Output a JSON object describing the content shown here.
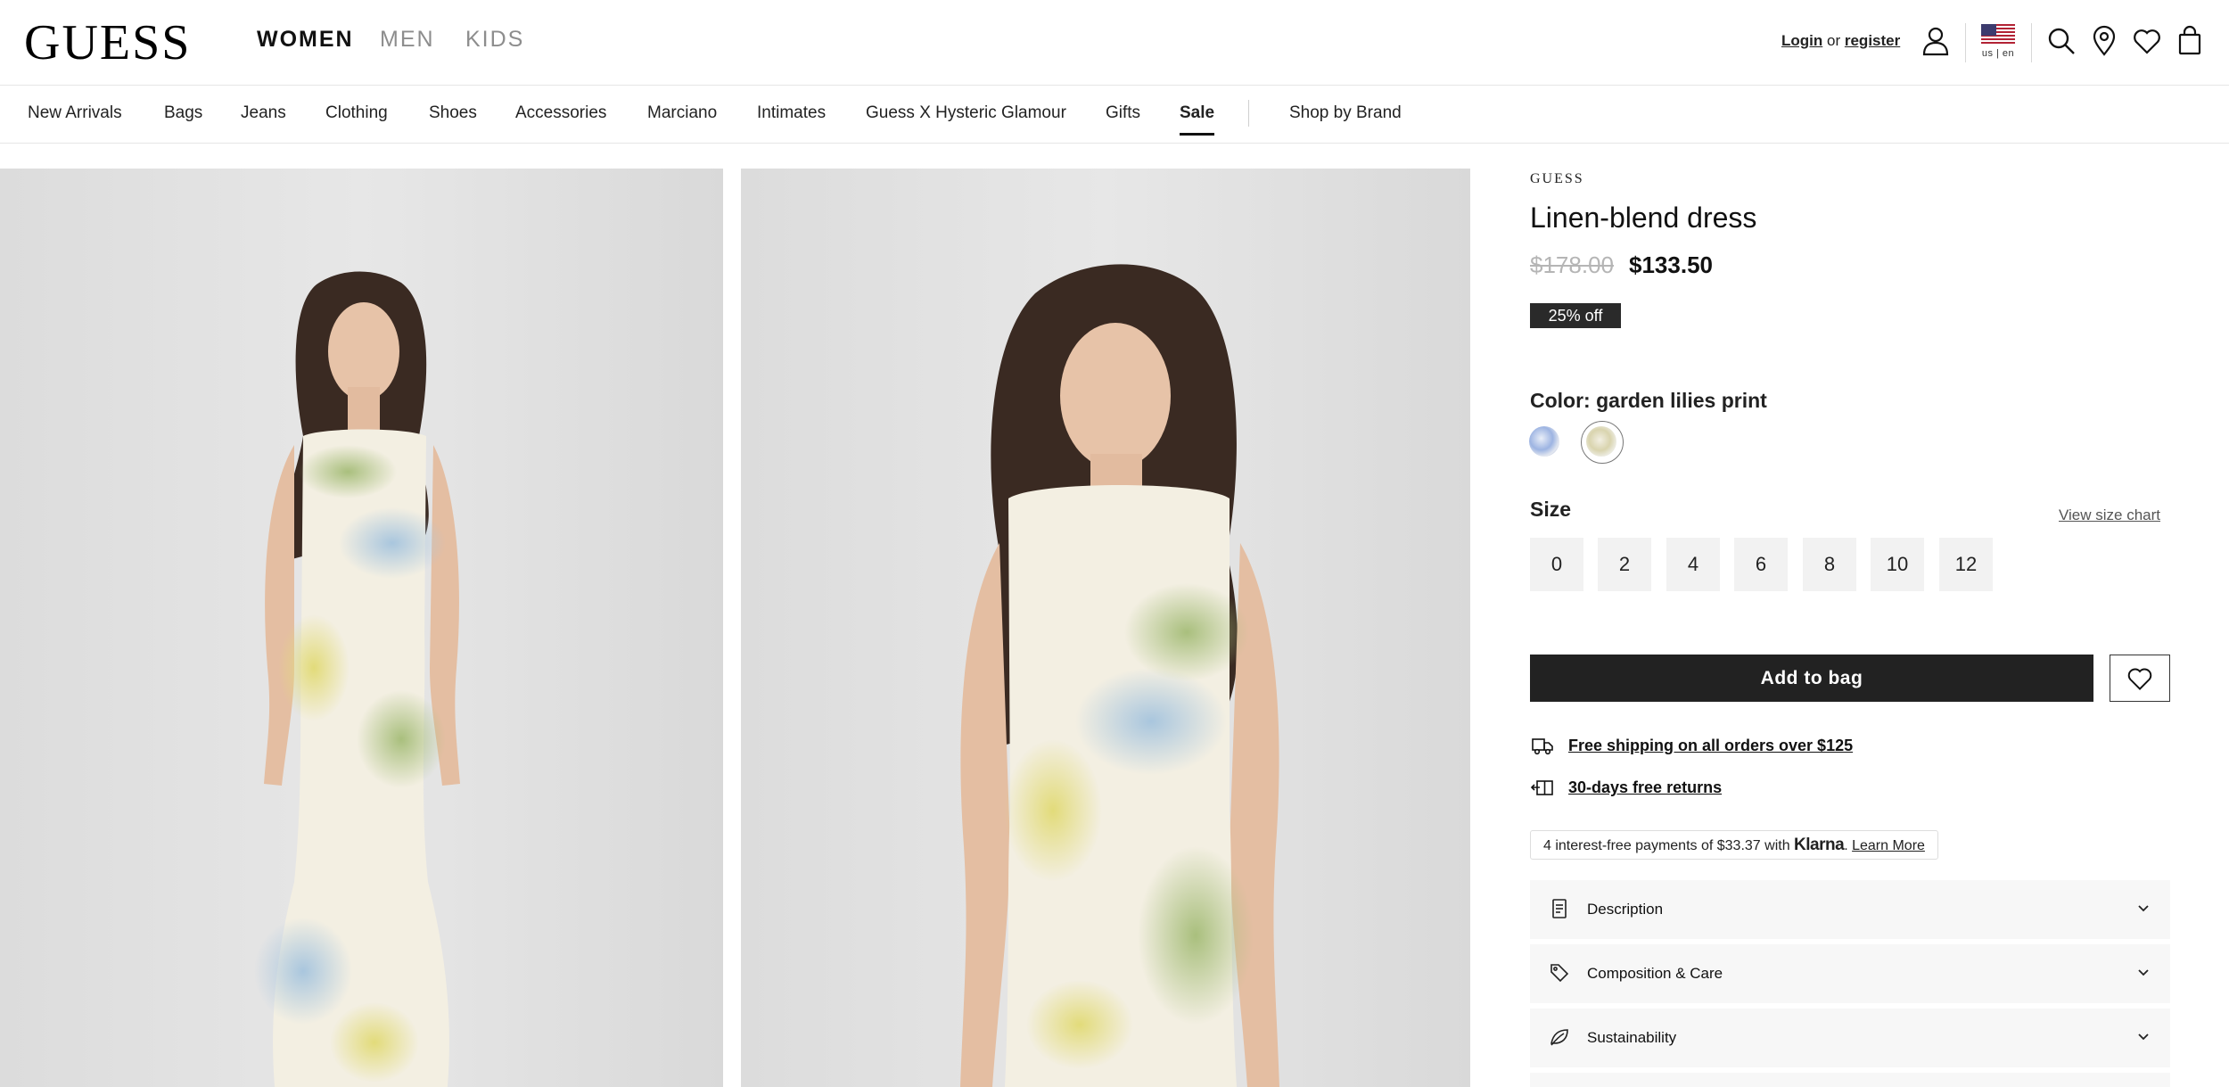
{
  "header": {
    "logo": "GUESS",
    "departments": [
      {
        "label": "WOMEN",
        "active": true
      },
      {
        "label": "MEN",
        "active": false
      },
      {
        "label": "KIDS",
        "active": false
      }
    ],
    "account": {
      "login": "Login",
      "or": "or",
      "register": "register"
    },
    "locale": "us | en",
    "icons": [
      "user-icon",
      "flag-icon",
      "search-icon",
      "location-pin-icon",
      "heart-icon",
      "shopping-bag-icon"
    ]
  },
  "categories": [
    {
      "label": "New Arrivals"
    },
    {
      "label": "Bags"
    },
    {
      "label": "Jeans"
    },
    {
      "label": "Clothing"
    },
    {
      "label": "Shoes"
    },
    {
      "label": "Accessories"
    },
    {
      "label": "Marciano"
    },
    {
      "label": "Intimates"
    },
    {
      "label": "Guess X Hysteric Glamour"
    },
    {
      "label": "Gifts"
    },
    {
      "label": "Sale",
      "active": true
    },
    {
      "label": "Shop by Brand"
    }
  ],
  "product": {
    "brand": "GUESS",
    "title": "Linen-blend dress",
    "original_price": "$178.00",
    "sale_price": "$133.50",
    "discount_badge": "25% off",
    "color_label": "Color: garden lilies print",
    "swatches": [
      {
        "name": "blue floral print",
        "selected": false,
        "color": "#9db4e2"
      },
      {
        "name": "garden lilies print",
        "selected": true,
        "color": "#d9d4ae"
      }
    ],
    "size_label": "Size",
    "size_chart_link": "View size chart",
    "sizes": [
      "0",
      "2",
      "4",
      "6",
      "8",
      "10",
      "12"
    ],
    "add_to_bag": "Add to bag",
    "perks": [
      "Free shipping on all orders over $125",
      "30-days free returns"
    ],
    "klarna": {
      "text": "4 interest-free payments of $33.37 with",
      "brand": "Klarna",
      "suffix": ".",
      "link": "Learn More"
    },
    "accordions": [
      {
        "label": "Description",
        "icon": "document-icon"
      },
      {
        "label": "Composition & Care",
        "icon": "tag-icon"
      },
      {
        "label": "Sustainability",
        "icon": "leaf-icon"
      }
    ]
  },
  "colors": {
    "accent": "#222222",
    "price_struck": "#b5b5b5",
    "badge_bg": "#2a2a2a",
    "accordion_bg": "#f7f7f7"
  }
}
